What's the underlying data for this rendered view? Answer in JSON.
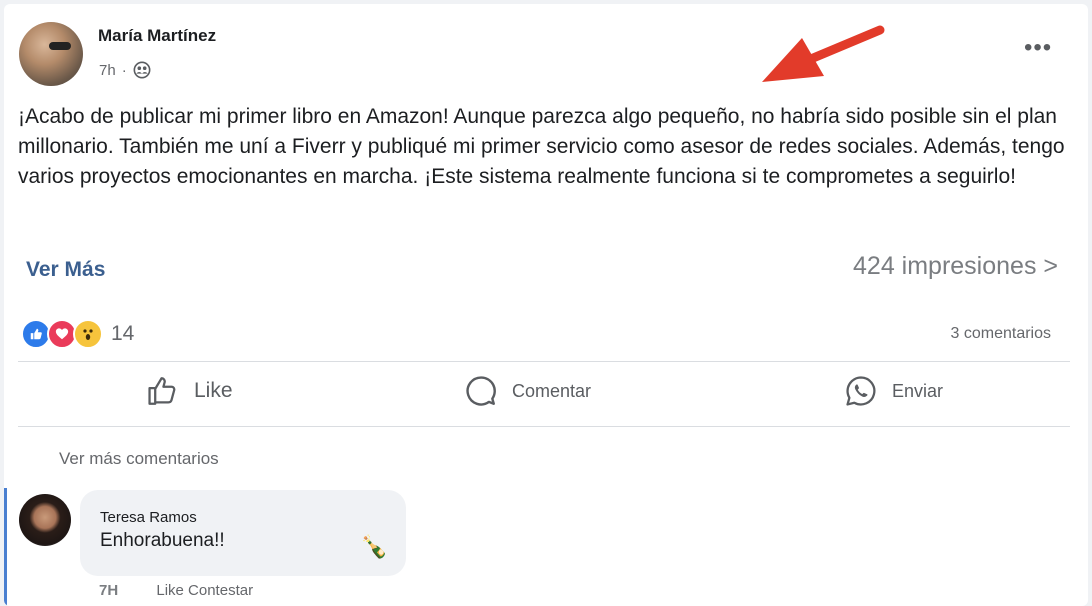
{
  "post": {
    "author": "María Martínez",
    "time": "7h",
    "separator": "·",
    "audience_icon": "people-icon",
    "more_label": "•••",
    "text": "¡Acabo de publicar mi primer libro en Amazon! Aunque parezca algo pequeño, no habría sido posible sin el plan millonario. También me uní a Fiverr y publiqué mi primer servicio como asesor de redes sociales. Además, tengo varios proyectos emocionantes en marcha. ¡Este sistema realmente funciona si te comprometes a seguirlo!",
    "see_more": "Ver Más",
    "impressions": "424 impresiones >"
  },
  "reactions": {
    "icons": [
      "like-icon",
      "love-icon",
      "wow-icon"
    ],
    "count": "14",
    "comments": "3 comentarios"
  },
  "actions": {
    "like": "Like",
    "comment": "Comentar",
    "send": "Enviar"
  },
  "comments": {
    "see_more": "Ver más comentarios",
    "items": [
      {
        "author": "Teresa Ramos",
        "text": "Enhorabuena!!",
        "emoji": "🍾",
        "time": "7H",
        "actions": "Like Contestar"
      }
    ]
  },
  "colors": {
    "arrow": "#e23b2a",
    "link": "#3b5f8f",
    "accent_bar": "#4a7fd0"
  }
}
